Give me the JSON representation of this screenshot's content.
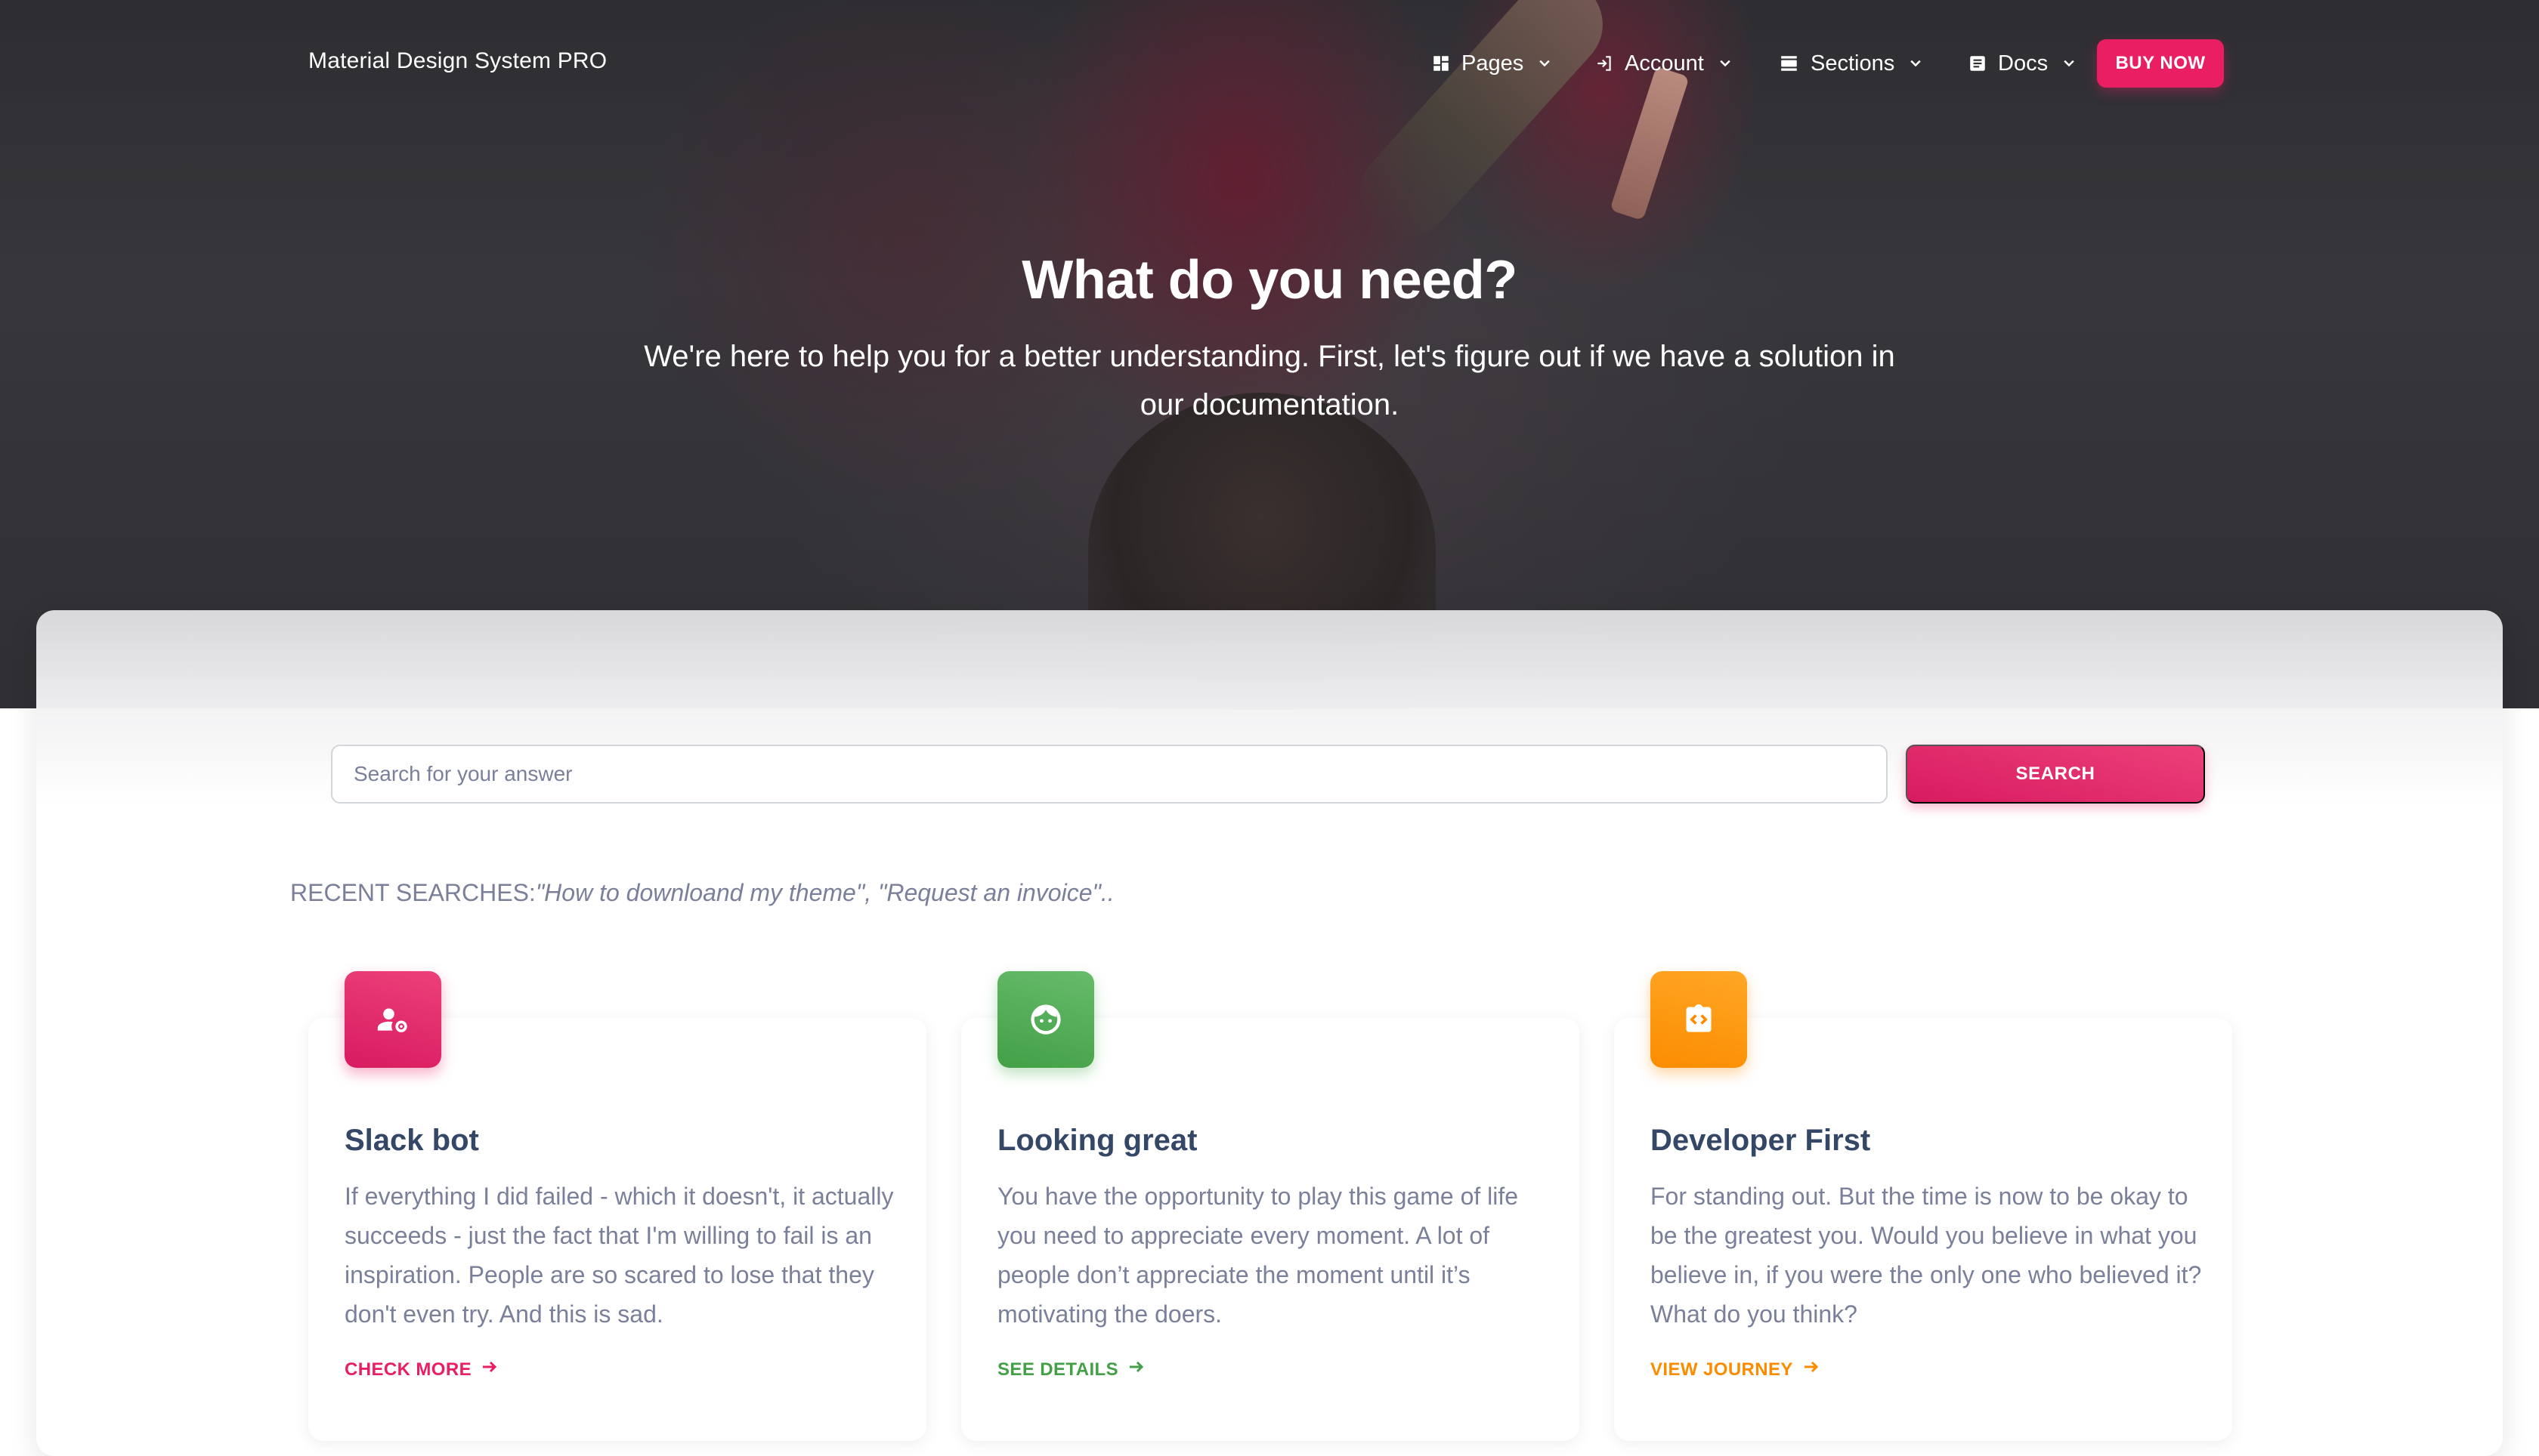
{
  "navbar": {
    "brand": "Material Design System PRO",
    "items": [
      {
        "label": "Pages",
        "icon": "dashboard-icon"
      },
      {
        "label": "Account",
        "icon": "login-icon"
      },
      {
        "label": "Sections",
        "icon": "view-day-icon"
      },
      {
        "label": "Docs",
        "icon": "article-icon"
      }
    ],
    "buy_label": "BUY NOW"
  },
  "hero": {
    "title": "What do you need?",
    "subtitle": "We're here to help you for a better understanding. First, let's figure out if we have a solution in our documentation."
  },
  "search": {
    "placeholder": "Search for your answer",
    "button_label": "SEARCH"
  },
  "recent": {
    "label": "RECENT SEARCHES:",
    "items": "\"How to downloand my theme\", \"Request an invoice\".."
  },
  "features": [
    {
      "icon": "manage-accounts-icon",
      "title": "Slack bot",
      "text": "If everything I did failed - which it doesn't, it actually succeeds - just the fact that I'm willing to fail is an inspiration. People are so scared to lose that they don't even try. And this is sad.",
      "link": "CHECK MORE",
      "color": "#e91e63"
    },
    {
      "icon": "face-icon",
      "title": "Looking great",
      "text": "You have the opportunity to play this game of life you need to appreciate every moment. A lot of people don’t appreciate the moment until it’s motivating the doers.",
      "link": "SEE DETAILS",
      "color": "#43a047"
    },
    {
      "icon": "integration-instructions-icon",
      "title": "Developer First",
      "text": "For standing out. But the time is now to be okay to be the greatest you. Would you believe in what you believe in, if you were the only one who believed it? What do you think?",
      "link": "VIEW JOURNEY",
      "color": "#fb8c00"
    }
  ]
}
